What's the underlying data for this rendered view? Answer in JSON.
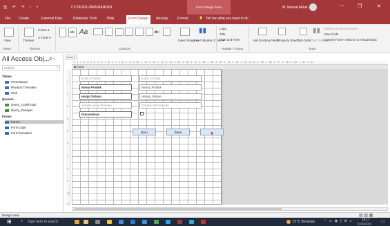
{
  "app": {
    "quick_access": "🖫 ↶ ↷ ▫ ▾",
    "doc_title": "CV PETRUJAYA MANDIRI",
    "context_tab": "Form Design Tools",
    "user_name": "M. Nauval Akbar",
    "window_controls": [
      "—",
      "❐",
      "✕"
    ]
  },
  "ribbon_tabs": [
    "File",
    "Create",
    "External Data",
    "Database Tools",
    "Help",
    "Form Design",
    "Arrange",
    "Format",
    "Tell me what you want to do"
  ],
  "active_tab": "Form Design",
  "ribbon": {
    "view_label": "View",
    "views_group": "Views",
    "themes_label": "Themes",
    "colors_label": "Colors ▾",
    "fonts_label": "A Fonts ▾",
    "themes_group": "Themes",
    "controls_group": "Controls",
    "insert_image": "Insert Image ▾",
    "insert_modern_chart": "Insert Modern Chart ▾",
    "logo": "Logo",
    "title": "Title",
    "date_time": "Date and Time",
    "header_group": "Header / Footer",
    "add_existing_fields": "Add Existing Fields",
    "property_sheet": "Property Sheet",
    "tab_order": "Tab Order",
    "chart_settings": "Chart Settings",
    "subform": "Subform in New Window",
    "view_code": "View Code",
    "convert_macros": "Convert Form's Macros to Visual Basic",
    "tools_group": "Tools"
  },
  "nav": {
    "title": "All Access Obj...",
    "title_controls": "⊙ ‹",
    "search_placeholder": "Search...",
    "sections": [
      {
        "header": "Tables",
        "items": [
          "Pemesanan",
          "Riwayat Transaksi",
          "Stok"
        ]
      },
      {
        "header": "Queries",
        "items": [
          "Query_Confirmasi",
          "Query_Riwayat"
        ]
      },
      {
        "header": "Forms",
        "items": [
          "Form1",
          "FormLogin",
          "FormTransaksi"
        ]
      }
    ],
    "selected_item": "Form1"
  },
  "document": {
    "tab_label": "Form1",
    "section_label": "◆ Detail",
    "ruler_text": "· 1 · 1 · 2 · 1 · 3 · 1 · 4 · 1 · 5 · 1 · 6 · 1 · 7 · 1 · 8 · 1 · 9 · 1 · 10 · 1 · 11 · 1 · 12 · 1 · 13 · 1 · 14 · 1 · 15 · 1 · 16 · 1 · 17 · 1 · 18 · 1 · 19 · 1 · 20 · 1 · 21 · 1 · 22 · 1 · 23 · 1 · 24 · 1 · 25 · 1 · 26 · 1 · 27 · 1 · 28 · 1 · 29 · 1 · 30 · 1 · 31",
    "vruler": [
      "1",
      "2",
      "3",
      "4",
      "5",
      "6",
      "7",
      "8",
      "9",
      "10",
      "11"
    ]
  },
  "form_controls": {
    "label_kode": "Kode_Produk",
    "field_kode": "Kode_Produk",
    "label_nama": "Nama Produk",
    "field_nama": "Nama_Produk",
    "label_harga": "Harga Satuan",
    "field_harga": "Harga_Satuan",
    "label_jumlah": "Jumlah yang Tersedia",
    "field_jumlah": "Jumlah_Persediaan",
    "label_disc": "Discontinue",
    "btn_baru": "Baru",
    "btn_batal": "Batal",
    "btn_save": "🖫"
  },
  "status_bar": {
    "text": "Design View",
    "view_icons": "▤ ▥ ▦"
  },
  "taskbar": {
    "search_placeholder": "Type here to search",
    "weather": "21°C Berawan",
    "time": "19:17",
    "date": "01/02/2024"
  },
  "colors": {
    "accent": "#a4373a",
    "taskbar": "#1f2b3a"
  }
}
